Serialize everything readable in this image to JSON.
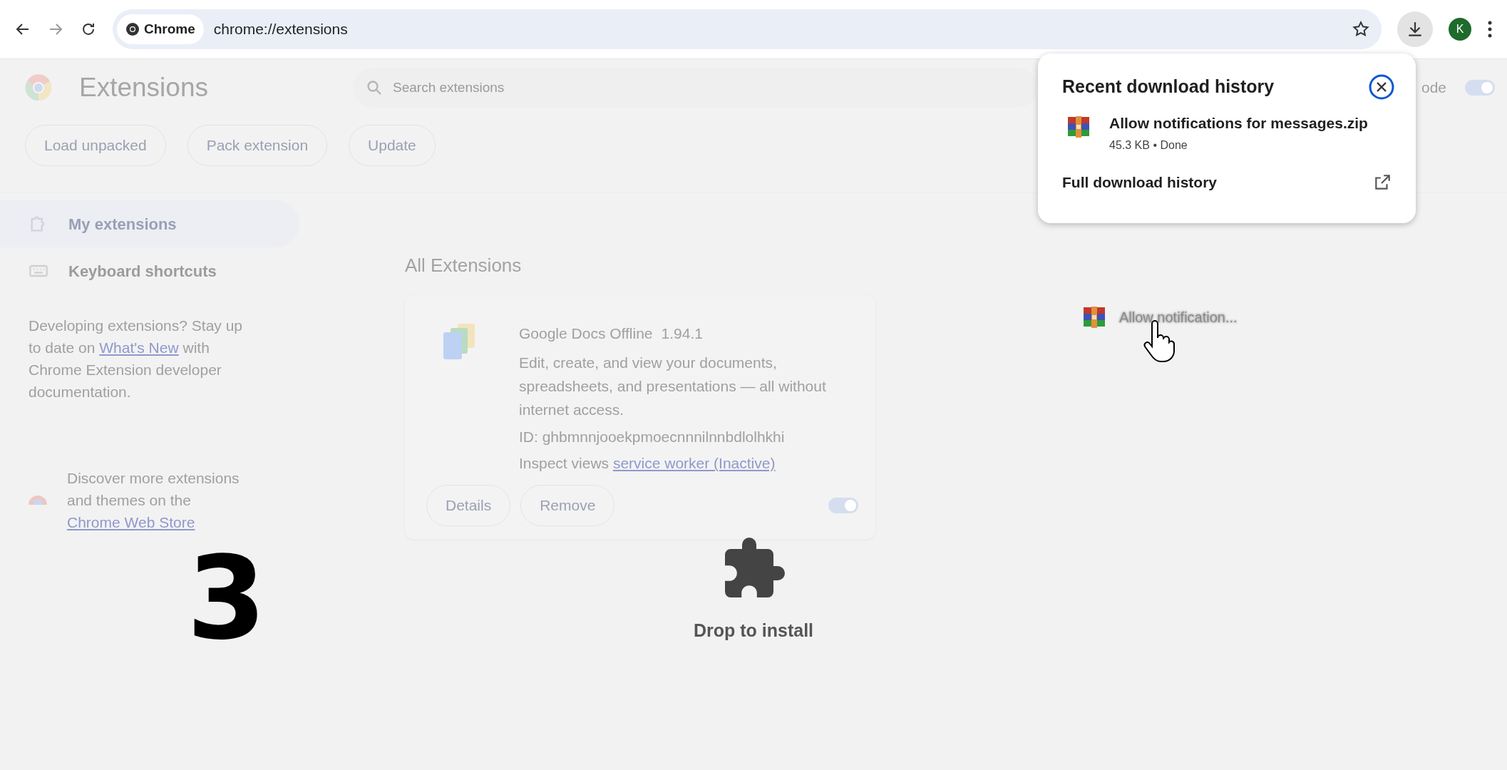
{
  "toolbar": {
    "chip": "Chrome",
    "url": "chrome://extensions",
    "avatar": "K"
  },
  "page": {
    "title": "Extensions",
    "search": {
      "placeholder": "Search extensions"
    },
    "dev_mode": {
      "label": "ode",
      "on": true
    },
    "actions": [
      "Load unpacked",
      "Pack extension",
      "Update"
    ],
    "sidebar": {
      "items": [
        {
          "label": "My extensions",
          "selected": true,
          "kind": "puzzle"
        },
        {
          "label": "Keyboard shortcuts",
          "selected": false,
          "kind": "keyboard"
        }
      ],
      "dev_note": {
        "before": "Developing extensions? Stay up to date on ",
        "link": "What's New",
        "after": " with Chrome Extension developer documentation."
      },
      "discover": {
        "before": "Discover more extensions and themes on the ",
        "link": "Chrome Web Store"
      }
    },
    "section_title": "All Extensions",
    "extensions": [
      {
        "name": "Google Docs Offline",
        "version": "1.94.1",
        "description": "Edit, create, and view your documents, spreadsheets, and presentations — all without internet access.",
        "id": "ID: ghbmnnjooekpmoecnnnilnnbdlolhkhi",
        "inspect_label": "Inspect views",
        "inspect_link": "service worker (Inactive)",
        "buttons": [
          "Details",
          "Remove"
        ],
        "enabled": true
      }
    ]
  },
  "downloads_popup": {
    "title": "Recent download history",
    "items": [
      {
        "name": "Allow notifications for messages.zip",
        "status": "45.3 KB • Done"
      }
    ],
    "footer": "Full download history"
  },
  "drag_item": {
    "label": "Allow notification..."
  },
  "drop_zone": {
    "label": "Drop to install"
  },
  "step_number": "3"
}
